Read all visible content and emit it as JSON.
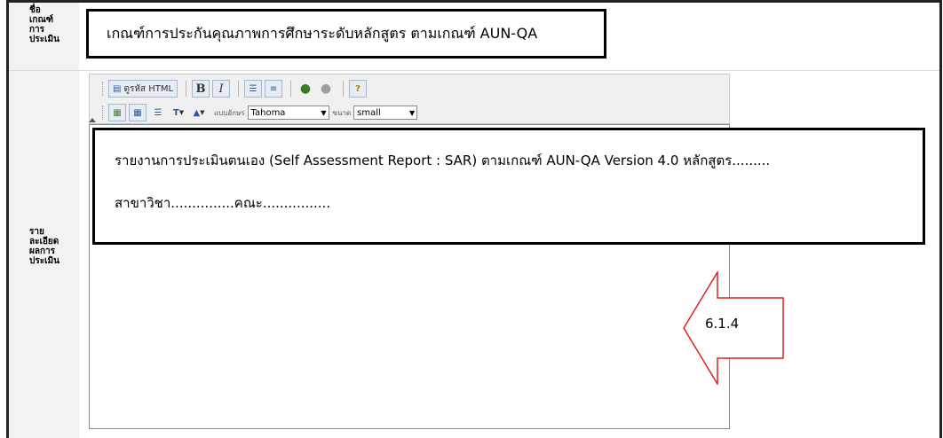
{
  "labels": {
    "criteria_name": [
      "ชื่อ",
      "เกณฑ์",
      "การ",
      "ประเมิน"
    ],
    "result_details": [
      "ราย",
      "ละเอียด",
      "ผลการ",
      "ประเมิน"
    ]
  },
  "criteria_title": "เกณฑ์การประกันคุณภาพการศึกษาระดับหลักสูตร ตามเกณฑ์ AUN-QA",
  "toolbar": {
    "html_code_label": "ดูรหัส HTML",
    "bold_label": "B",
    "italic_label": "I",
    "help_label": "?",
    "font_family_label": "แบบอักษร",
    "font_family_value": "Tahoma",
    "font_size_label": "ขนาด",
    "font_size_value": "small"
  },
  "editor": {
    "line1": "รายงานการประเมินตนเอง (Self Assessment Report : SAR) ตามเกณฑ์ AUN-QA Version 4.0 หลักสูตร.........",
    "line2": "สาขาวิชา...............คณะ................"
  },
  "annotation": {
    "label": "6.1.4",
    "color": "#e02020"
  }
}
